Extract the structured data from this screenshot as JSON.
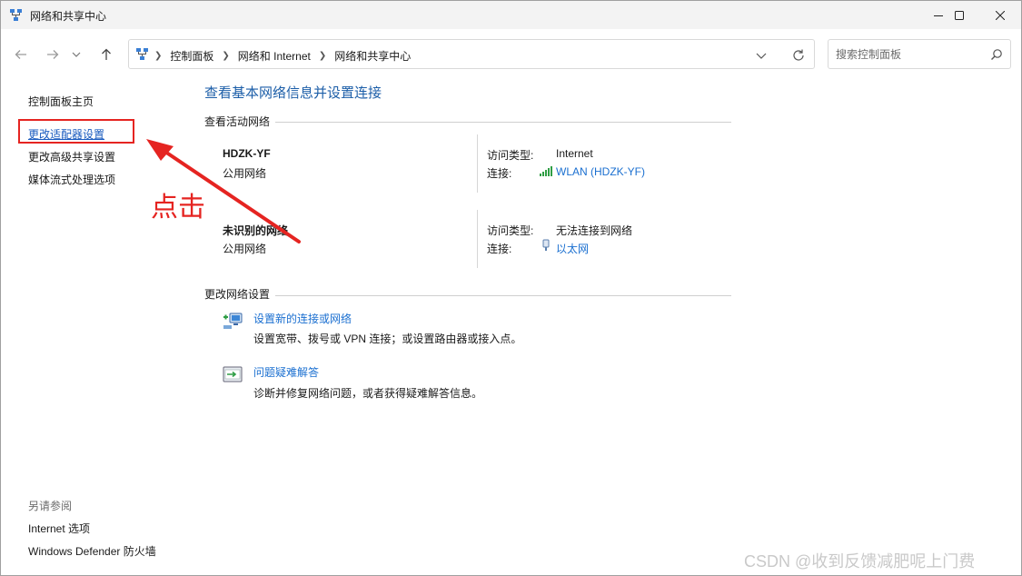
{
  "window": {
    "title": "网络和共享中心",
    "controls": {
      "minimize": "minimize-icon",
      "maximize": "maximize-icon",
      "close": "close-icon"
    }
  },
  "address": {
    "breadcrumbs": [
      "控制面板",
      "网络和 Internet",
      "网络和共享中心"
    ],
    "search_placeholder": "搜索控制面板"
  },
  "sidebar": {
    "links": [
      {
        "label": "控制面板主页",
        "active": false
      },
      {
        "label": "更改适配器设置",
        "active": true
      },
      {
        "label": "更改高级共享设置",
        "active": false
      },
      {
        "label": "媒体流式处理选项",
        "active": false
      }
    ],
    "see_also_title": "另请参阅",
    "see_also": [
      "Internet 选项",
      "Windows Defender 防火墙"
    ]
  },
  "main": {
    "heading": "查看基本网络信息并设置连接",
    "active_networks_title": "查看活动网络",
    "networks": [
      {
        "name": "HDZK-YF",
        "type": "公用网络",
        "access_label": "访问类型:",
        "access_value": "Internet",
        "connection_label": "连接:",
        "connection_value": "WLAN (HDZK-YF)",
        "connection_icon": "wifi-signal-icon"
      },
      {
        "name": "未识别的网络",
        "type": "公用网络",
        "access_label": "访问类型:",
        "access_value": "无法连接到网络",
        "connection_label": "连接:",
        "connection_value": "以太网",
        "connection_icon": "ethernet-plug-icon"
      }
    ],
    "change_settings_title": "更改网络设置",
    "tasks": [
      {
        "label": "设置新的连接或网络",
        "description": "设置宽带、拨号或 VPN 连接；或设置路由器或接入点。",
        "icon": "new-connection-icon"
      },
      {
        "label": "问题疑难解答",
        "description": "诊断并修复网络问题，或者获得疑难解答信息。",
        "icon": "troubleshoot-icon"
      }
    ]
  },
  "annotation": {
    "text": "点击",
    "color": "#e52421"
  },
  "watermark": "CSDN @收到反馈减肥呢上门费",
  "colors": {
    "link": "#1a6fd0",
    "heading": "#1c5ea8",
    "annotation": "#e52421"
  }
}
